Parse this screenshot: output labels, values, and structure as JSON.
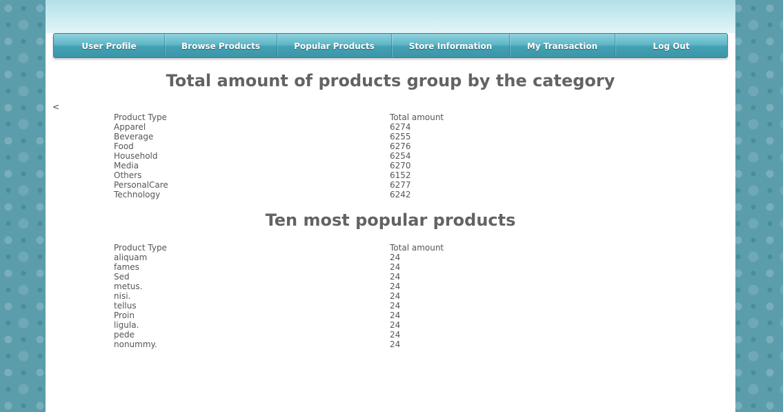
{
  "nav": {
    "items": [
      "User Profile",
      "Browse Products",
      "Popular Products",
      "Store Information",
      "My Transaction",
      "Log Out"
    ]
  },
  "category_section": {
    "title": "Total amount of products group by the category",
    "stray_text": "<",
    "headers": [
      "Product Type",
      "Total amount"
    ],
    "rows": [
      [
        "Apparel",
        "6274"
      ],
      [
        "Beverage",
        "6255"
      ],
      [
        "Food",
        "6276"
      ],
      [
        "Household",
        "6254"
      ],
      [
        "Media",
        "6270"
      ],
      [
        "Others",
        "6152"
      ],
      [
        "PersonalCare",
        "6277"
      ],
      [
        "Technology",
        "6242"
      ]
    ]
  },
  "popular_section": {
    "title": "Ten most popular products",
    "headers": [
      "Product Type",
      "Total amount"
    ],
    "rows": [
      [
        "aliquam",
        "24"
      ],
      [
        "fames",
        "24"
      ],
      [
        "Sed",
        "24"
      ],
      [
        "metus.",
        "24"
      ],
      [
        "nisi.",
        "24"
      ],
      [
        "tellus",
        "24"
      ],
      [
        "Proin",
        "24"
      ],
      [
        "ligula.",
        "24"
      ],
      [
        "pede",
        "24"
      ],
      [
        "nonummy.",
        "24"
      ]
    ]
  }
}
